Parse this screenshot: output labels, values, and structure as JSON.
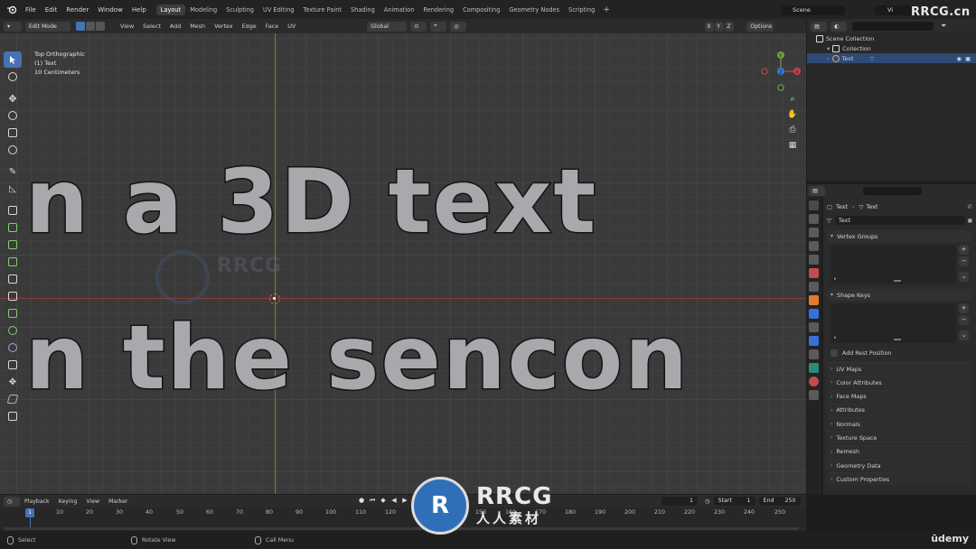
{
  "topbar": {
    "menus": [
      "File",
      "Edit",
      "Render",
      "Window",
      "Help"
    ],
    "workspaces": [
      "Layout",
      "Modeling",
      "Sculpting",
      "UV Editing",
      "Texture Paint",
      "Shading",
      "Animation",
      "Rendering",
      "Compositing",
      "Geometry Nodes",
      "Scripting"
    ],
    "active_workspace": "Layout",
    "add_tab": "+",
    "scene": "Scene",
    "view_layer": "Vi",
    "watermark": "RRCG.cn"
  },
  "viewport_header": {
    "mode": "Edit Mode",
    "menus": [
      "View",
      "Select",
      "Add",
      "Mesh",
      "Vertex",
      "Edge",
      "Face",
      "UV"
    ],
    "orientation": "Global",
    "axes": [
      "X",
      "Y",
      "Z"
    ],
    "options": "Options"
  },
  "viewport": {
    "view_name": "Top Orthographic",
    "object": "(1) Text",
    "scale": "10 Centimeters",
    "row1_text": "n a 3D text",
    "row2_text": "n the sencon",
    "overlay_watermark": "RRCG"
  },
  "gizmo": {
    "x": "X",
    "y": "Y",
    "z": "Z"
  },
  "outliner": {
    "scene_collection": "Scene Collection",
    "collection": "Collection",
    "object": "Text"
  },
  "properties": {
    "crumb_object": "Text",
    "crumb_data": "Text",
    "data_name": "Text",
    "vertex_groups": "Vertex Groups",
    "shape_keys": "Shape Keys",
    "add_rest_position": "Add Rest Position",
    "collapsed_panels": [
      "UV Maps",
      "Color Attributes",
      "Face Maps",
      "Attributes",
      "Normals",
      "Texture Space",
      "Remesh",
      "Geometry Data",
      "Custom Properties"
    ],
    "plus": "+",
    "minus": "−",
    "down": "⌄"
  },
  "timeline": {
    "menus": [
      "Playback",
      "Keying",
      "View",
      "Marker"
    ],
    "current_frame": "1",
    "start_label": "Start",
    "start": "1",
    "end_label": "End",
    "end": "250",
    "ticks": [
      "1",
      "10",
      "20",
      "30",
      "40",
      "50",
      "60",
      "70",
      "80",
      "90",
      "100",
      "110",
      "120",
      "130",
      "140",
      "150",
      "160",
      "170",
      "180",
      "190",
      "200",
      "210",
      "220",
      "230",
      "240",
      "250"
    ]
  },
  "status_bar": {
    "select": "Select",
    "rotate_view": "Rotate View",
    "call_menu": "Call Menu",
    "brand": "ūdemy"
  },
  "center_watermark": {
    "big": "RRCG",
    "small": "人人素材"
  },
  "colors": {
    "accent": "#4772b3",
    "x_axis": "#c8424a",
    "y_axis": "#6ea23c",
    "z_axis": "#3a7ad6"
  }
}
